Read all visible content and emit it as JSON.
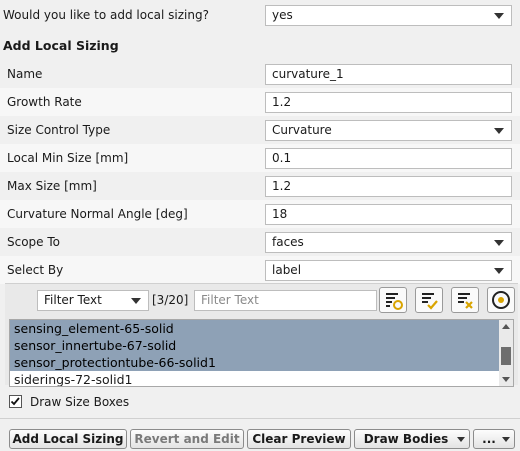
{
  "question": {
    "label": "Would you like to add local sizing?",
    "value": "yes"
  },
  "section_title": "Add Local Sizing",
  "fields": [
    {
      "label": "Name",
      "value": "curvature_1",
      "type": "text"
    },
    {
      "label": "Growth Rate",
      "value": "1.2",
      "type": "text"
    },
    {
      "label": "Size Control Type",
      "value": "Curvature",
      "type": "dropdown"
    },
    {
      "label": "Local Min Size [mm]",
      "value": "0.1",
      "type": "text"
    },
    {
      "label": "Max Size [mm]",
      "value": "1.2",
      "type": "text"
    },
    {
      "label": "Curvature Normal Angle [deg]",
      "value": "18",
      "type": "text"
    },
    {
      "label": "Scope To",
      "value": "faces",
      "type": "dropdown"
    },
    {
      "label": "Select By",
      "value": "label",
      "type": "dropdown"
    }
  ],
  "filter": {
    "type_value": "Filter Text",
    "count": "[3/20]",
    "placeholder": "Filter Text",
    "icons": [
      "filter-new-icon",
      "filter-check-icon",
      "filter-clear-icon",
      "target-icon"
    ]
  },
  "list_items": [
    {
      "label": "sensing_element-65-solid",
      "selected": true
    },
    {
      "label": "sensor_innertube-67-solid",
      "selected": true
    },
    {
      "label": "sensor_protectiontube-66-solid1",
      "selected": true
    },
    {
      "label": "siderings-72-solid1",
      "selected": false
    }
  ],
  "draw_size_boxes": {
    "label": "Draw Size Boxes",
    "checked": true
  },
  "footer": {
    "add_local_sizing": "Add Local Sizing",
    "revert_and_edit": "Revert and Edit",
    "clear_preview": "Clear Preview",
    "draw_bodies": "Draw Bodies",
    "more": "..."
  }
}
